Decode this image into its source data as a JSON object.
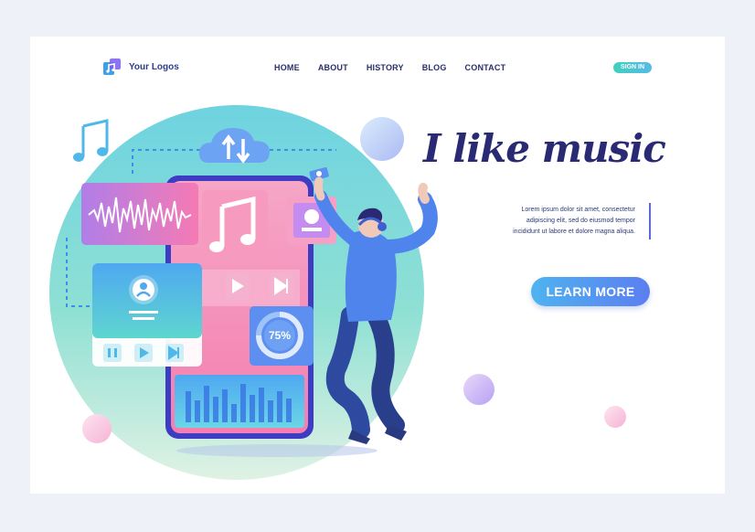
{
  "header": {
    "logo_text": "Your Logos",
    "nav": [
      "HOME",
      "ABOUT",
      "HISTORY",
      "BLOG",
      "CONTACT"
    ],
    "signin_label": "SIGN IN"
  },
  "hero": {
    "title": "I like music",
    "body_lines": [
      "Lorem ipsum dolor sit amet, consectetur",
      "adipiscing elit, sed do eiusmod tempor",
      "incididunt ut labore et dolore magna aliqua."
    ],
    "cta_label": "LEARN MORE"
  },
  "illustration": {
    "progress_label": "75%",
    "progress_value": 0.75,
    "icons": [
      "music-note-icon",
      "cloud-sync-icon",
      "play-icon",
      "pause-icon",
      "next-icon",
      "user-icon",
      "headphones-icon"
    ]
  },
  "colors": {
    "navy": "#2a2a74",
    "accent_blue": "#5b7ef0",
    "phone_pink": "#f47eb0",
    "teal": "#3fd0c0"
  }
}
